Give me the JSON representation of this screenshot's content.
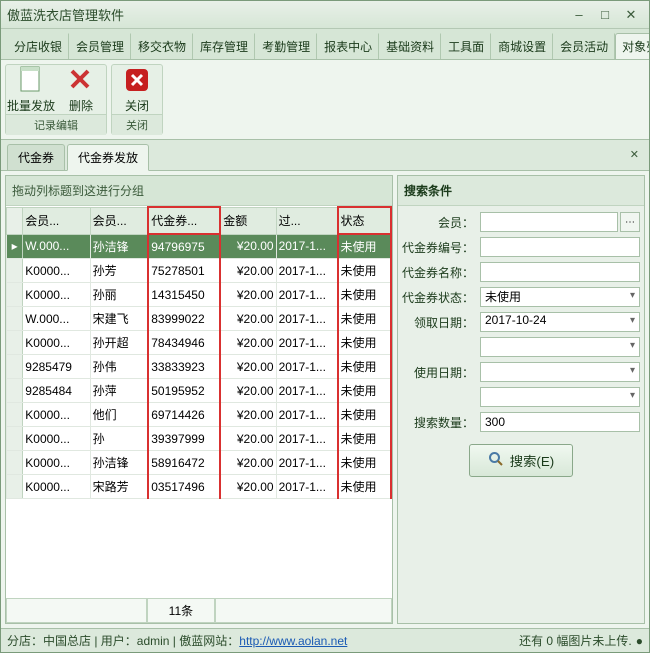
{
  "window": {
    "title": "傲蓝洗衣店管理软件"
  },
  "mainTabs": [
    "分店收银",
    "会员管理",
    "移交衣物",
    "库存管理",
    "考勤管理",
    "报表中心",
    "基础资料",
    "工具面",
    "商城设置",
    "会员活动",
    "对象列"
  ],
  "mainTabActive": 10,
  "ribbon": {
    "group1": {
      "btn1": "批量发放",
      "btn2": "删除",
      "label": "记录编辑"
    },
    "group2": {
      "btn1": "关闭",
      "label": "关闭"
    }
  },
  "subTabs": [
    "代金券",
    "代金券发放"
  ],
  "subTabActive": 1,
  "groupHeader": "拖动列标题到这进行分组",
  "grid": {
    "headers": [
      "会员...",
      "会员...",
      "代金券...",
      "金额",
      "过...",
      " 状态"
    ],
    "rows": [
      {
        "sel": true,
        "c0": "W.000...",
        "c1": "孙洁锋",
        "c2": "94796975",
        "c3": "¥20.00",
        "c4": "2017-1...",
        "c5": "未使用"
      },
      {
        "sel": false,
        "c0": "K0000...",
        "c1": "孙芳",
        "c2": "75278501",
        "c3": "¥20.00",
        "c4": "2017-1...",
        "c5": "未使用"
      },
      {
        "sel": false,
        "c0": "K0000...",
        "c1": "孙丽",
        "c2": "14315450",
        "c3": "¥20.00",
        "c4": "2017-1...",
        "c5": "未使用"
      },
      {
        "sel": false,
        "c0": "W.000...",
        "c1": "宋建飞",
        "c2": "83999022",
        "c3": "¥20.00",
        "c4": "2017-1...",
        "c5": "未使用"
      },
      {
        "sel": false,
        "c0": "K0000...",
        "c1": "孙开超",
        "c2": "78434946",
        "c3": "¥20.00",
        "c4": "2017-1...",
        "c5": "未使用"
      },
      {
        "sel": false,
        "c0": "9285479",
        "c1": "孙伟",
        "c2": "33833923",
        "c3": "¥20.00",
        "c4": "2017-1...",
        "c5": "未使用"
      },
      {
        "sel": false,
        "c0": "9285484",
        "c1": "孙萍",
        "c2": "50195952",
        "c3": "¥20.00",
        "c4": "2017-1...",
        "c5": "未使用"
      },
      {
        "sel": false,
        "c0": "K0000...",
        "c1": "他们",
        "c2": "69714426",
        "c3": "¥20.00",
        "c4": "2017-1...",
        "c5": "未使用"
      },
      {
        "sel": false,
        "c0": "K0000...",
        "c1": "孙",
        "c2": "39397999",
        "c3": "¥20.00",
        "c4": "2017-1...",
        "c5": "未使用"
      },
      {
        "sel": false,
        "c0": "K0000...",
        "c1": "孙洁锋",
        "c2": "58916472",
        "c3": "¥20.00",
        "c4": "2017-1...",
        "c5": "未使用"
      },
      {
        "sel": false,
        "c0": "K0000...",
        "c1": "宋路芳",
        "c2": "03517496",
        "c3": "¥20.00",
        "c4": "2017-1...",
        "c5": "未使用"
      }
    ],
    "footer": "11条"
  },
  "search": {
    "title": "搜索条件",
    "labels": {
      "member": "会员：",
      "voucherNo": "代金券编号：",
      "voucherName": "代金券名称：",
      "voucherStatus": "代金券状态：",
      "receiveDate": "领取日期：",
      "blank1": "",
      "useDate": "使用日期：",
      "blank2": "",
      "qty": "搜索数量："
    },
    "values": {
      "status": "未使用",
      "receiveDate": "2017-10-24",
      "qty": "300"
    },
    "button": "搜索(E)"
  },
  "statusbar": {
    "left": "分店：中国总店 | 用户：admin  |  傲蓝网站：",
    "link": "http://www.aolan.net",
    "right": "还有 0 幅图片未上传."
  }
}
